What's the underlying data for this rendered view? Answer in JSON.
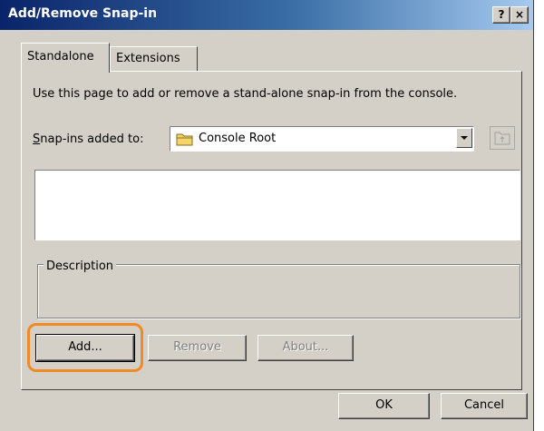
{
  "window": {
    "title": "Add/Remove Snap-in",
    "help_glyph": "?",
    "close_glyph": "×"
  },
  "tabs": [
    {
      "label": "Standalone",
      "active": true
    },
    {
      "label": "Extensions",
      "active": false
    }
  ],
  "content": {
    "instructions": "Use this page to add or remove a stand-alone snap-in from the console.",
    "snapins_label": "Snap-ins added to:",
    "combo_value": "Console Root",
    "description_label": "Description"
  },
  "buttons": {
    "add": "Add...",
    "remove": "Remove",
    "about": "About...",
    "ok": "OK",
    "cancel": "Cancel"
  },
  "icons": [
    "folder-icon",
    "dropdown-arrow-icon",
    "folder-up-icon",
    "help-icon",
    "close-icon"
  ],
  "colors": {
    "face": "#d4d0c8",
    "title_start": "#0a246a",
    "title_end": "#a6caf0",
    "highlight": "#f08a24",
    "disabled_text": "#808080"
  }
}
